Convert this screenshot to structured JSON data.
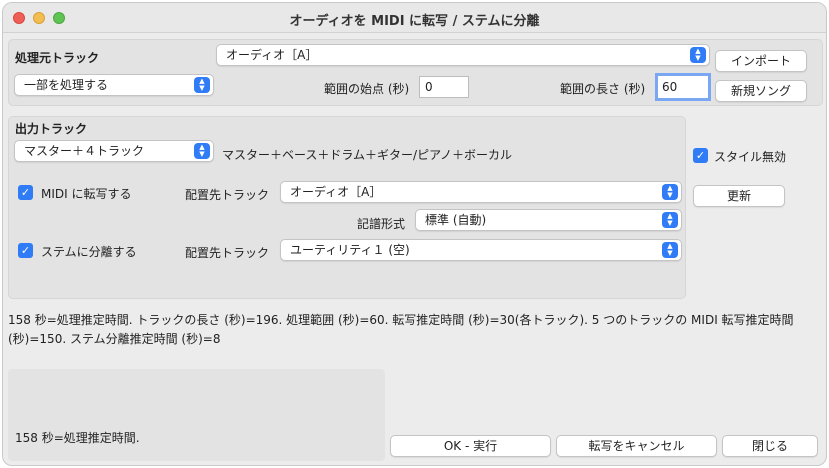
{
  "window": {
    "title": "オーディオを MIDI に転写 / ステムに分離"
  },
  "source": {
    "heading": "処理元トラック",
    "track_select": "オーディオ［A］",
    "mode_select": "一部を処理する",
    "start_label": "範囲の始点 (秒)",
    "start_value": "0",
    "length_label": "範囲の長さ (秒)",
    "length_value": "60",
    "import_button": "インポート",
    "new_song_button": "新規ソング"
  },
  "output": {
    "heading": "出力トラック",
    "stem_select": "マスター＋４トラック",
    "stem_description": "マスター＋ベース＋ドラム＋ギター/ピアノ＋ボーカル",
    "midi_checkbox_label": "MIDI に転写する",
    "midi_dest_label": "配置先トラック",
    "midi_dest_select": "オーディオ［A］",
    "notation_label": "記譜形式",
    "notation_select": "標準 (自動)",
    "stems_checkbox_label": "ステムに分離する",
    "stems_dest_label": "配置先トラック",
    "stems_dest_select": "ユーティリティ１ (空)"
  },
  "side": {
    "style_disable_label": "スタイル無効",
    "update_button": "更新"
  },
  "info_text": "158 秒=処理推定時間. トラックの長さ (秒)=196. 処理範囲 (秒)=60. 転写推定時間 (秒)=30(各トラック). 5 つのトラックの MIDI 転写推定時間 (秒)=150. ステム分離推定時間 (秒)=8",
  "status_text": "158 秒=処理推定時間.",
  "footer": {
    "ok_button": "OK - 実行",
    "cancel_button": "転写をキャンセル",
    "close_button": "閉じる"
  },
  "colors": {
    "accent": "#2f7cf6",
    "focus_ring": "#7aa7f2"
  }
}
